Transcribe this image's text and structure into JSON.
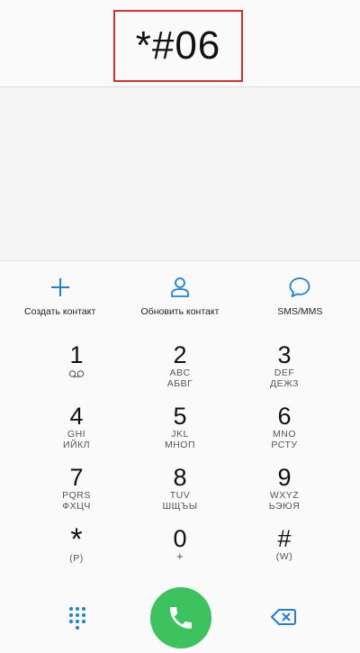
{
  "dialer": {
    "number": "*#06"
  },
  "actions": [
    {
      "label": "Создать контакт",
      "icon": "plus-icon"
    },
    {
      "label": "Обновить контакт",
      "icon": "person-icon"
    },
    {
      "label": "SMS/MMS",
      "icon": "chat-bubble-icon"
    }
  ],
  "keys": [
    {
      "digit": "1",
      "sub1": "",
      "sub2": "",
      "icon": "voicemail-icon"
    },
    {
      "digit": "2",
      "sub1": "ABC",
      "sub2": "АБВГ"
    },
    {
      "digit": "3",
      "sub1": "DEF",
      "sub2": "ДЕЖЗ"
    },
    {
      "digit": "4",
      "sub1": "GHI",
      "sub2": "ИЙКЛ"
    },
    {
      "digit": "5",
      "sub1": "JKL",
      "sub2": "МНОП"
    },
    {
      "digit": "6",
      "sub1": "MNO",
      "sub2": "РСТУ"
    },
    {
      "digit": "7",
      "sub1": "PQRS",
      "sub2": "ФХЦЧ"
    },
    {
      "digit": "8",
      "sub1": "TUV",
      "sub2": "ШЩЪЫ"
    },
    {
      "digit": "9",
      "sub1": "WXYZ",
      "sub2": "ЬЭЮЯ"
    },
    {
      "digit": "*",
      "sub1": "(P)",
      "sub2": ""
    },
    {
      "digit": "0",
      "sub1": "+",
      "sub2": ""
    },
    {
      "digit": "#",
      "sub1": "(W)",
      "sub2": ""
    }
  ],
  "bottom_bar": {
    "dialpad_icon": "dialpad-grid-icon",
    "call_icon": "phone-icon",
    "delete_icon": "backspace-icon"
  },
  "colors": {
    "accent": "#1f7fd6",
    "call_green": "#3cc25e",
    "highlight_border": "#d32f2f"
  }
}
